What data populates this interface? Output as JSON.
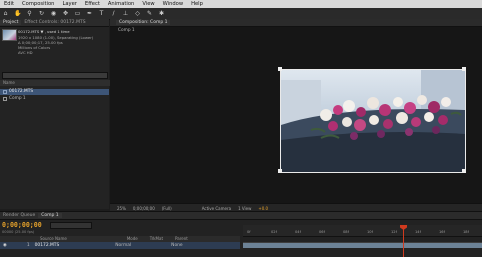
{
  "menu": [
    "Edit",
    "Composition",
    "Layer",
    "Effect",
    "Animation",
    "View",
    "Window",
    "Help"
  ],
  "toolbar_icons": [
    "home-icon",
    "hand-icon",
    "zoom-icon",
    "rotate-icon",
    "camera-icon",
    "pan-icon",
    "rectangle-mask-icon",
    "pen-icon",
    "text-icon",
    "brush-icon",
    "clone-stamp-icon",
    "eraser-icon",
    "roto-brush-icon",
    "puppet-pin-icon"
  ],
  "project": {
    "tabs": [
      "Project",
      "Effect Controls: 00172.MTS"
    ],
    "footage_name": "00172.MTS ▼ , used 1 time",
    "info_lines": [
      "1920 x 1080 (1.00), Separating (Lower)",
      "Δ 0;00;00;17, 25.00 fps",
      "Millions of Colors",
      "AVC HD"
    ],
    "header_label": "Name",
    "items": [
      {
        "name": "00172.MTS",
        "selected": true
      },
      {
        "name": "Comp 1",
        "selected": false
      }
    ],
    "bpc": "8 bpc"
  },
  "comp": {
    "tab_label": "Composition: Comp 1",
    "breadcrumb": "Comp 1",
    "viewer": {
      "zoom": "25%",
      "timecode": "0;00;00;00",
      "quality": "(Full)",
      "camera": "Active Camera",
      "views": "1 View",
      "offset": "+0.0"
    }
  },
  "timeline": {
    "tabs": [
      "Render Queue",
      "Comp 1"
    ],
    "timecode": "0;00;00;00",
    "frame_label": "00000 (25.00 fps)",
    "columns": [
      "Source Name",
      "Mode",
      "TrkMat",
      "Parent"
    ],
    "layer": {
      "number": "1",
      "name": "00172.MTS",
      "mode": "Normal",
      "parent": "None"
    },
    "ruler_ticks": [
      "0f",
      "02f",
      "04f",
      "06f",
      "08f",
      "10f",
      "12f",
      "14f",
      "16f",
      "18f"
    ]
  },
  "colors": {
    "accent_timecode": "#e3a02b",
    "selection": "#3d5577",
    "cti": "#d03a1e"
  }
}
